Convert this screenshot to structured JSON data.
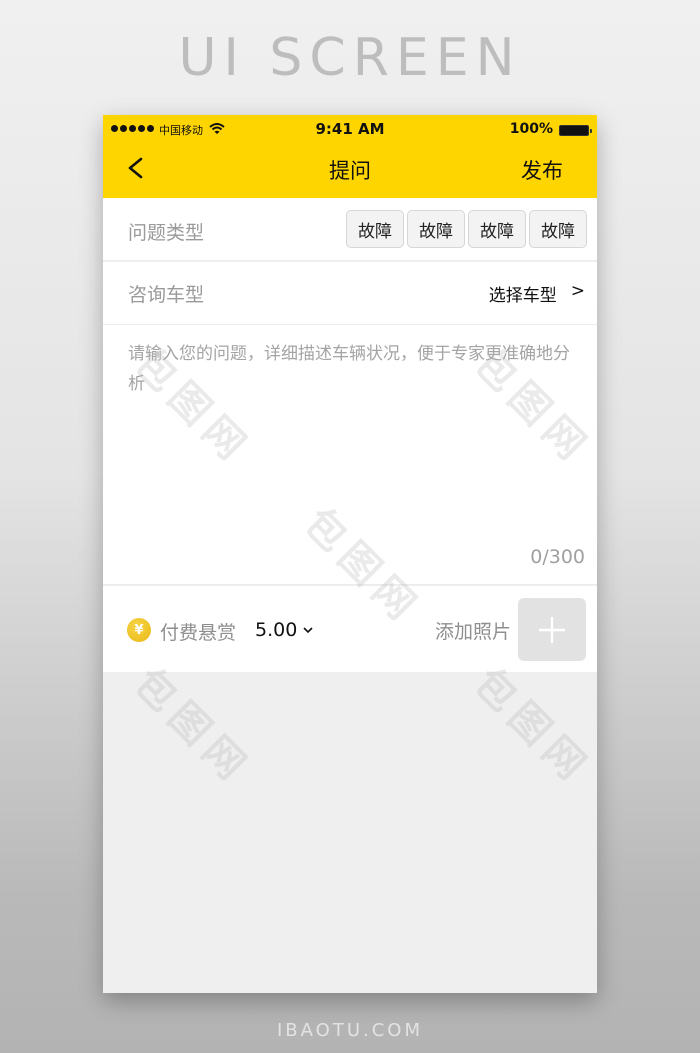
{
  "page": {
    "heading": "UI SCREEN",
    "footer": "IBAOTU.COM",
    "watermark_text": "包图网"
  },
  "status_bar": {
    "carrier": "中国移动",
    "time": "9:41 AM",
    "battery": "100%",
    "signal_icon": "signal-dots-icon",
    "wifi_icon": "wifi-icon",
    "battery_icon": "battery-icon"
  },
  "nav": {
    "back_icon": "chevron-left-icon",
    "title": "提问",
    "publish_label": "发布"
  },
  "form": {
    "question_type": {
      "label": "问题类型",
      "tags": [
        "故障",
        "故障",
        "故障",
        "故障"
      ]
    },
    "car_model": {
      "label": "咨询车型",
      "select_label": "选择车型",
      "arrow": ">"
    },
    "description": {
      "value": "",
      "placeholder": "请输入您的问题，详细描述车辆状况，便于专家更准确地分析",
      "char_count": "0/300"
    },
    "reward": {
      "coin_symbol": "¥",
      "label": "付费悬赏",
      "amount": "5.00"
    },
    "photo": {
      "label": "添加照片",
      "add_icon": "plus-icon"
    }
  },
  "colors": {
    "accent": "#FFD500",
    "coin": "#EBBE1E",
    "background": "#EFEFEF"
  }
}
